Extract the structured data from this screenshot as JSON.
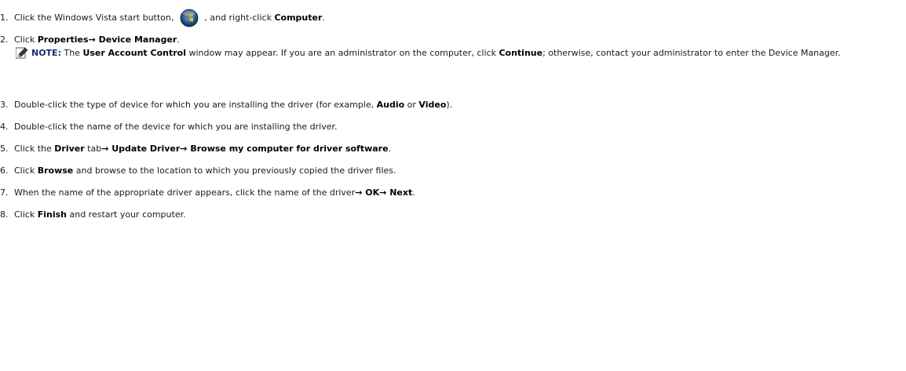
{
  "steps": [
    {
      "num": "1.",
      "parts": [
        {
          "t": "Click the Windows Vista start button, ",
          "b": false
        },
        {
          "icon": "windows-start-button"
        },
        {
          "t": " , and right-click ",
          "b": false
        },
        {
          "t": "Computer",
          "b": true
        },
        {
          "t": ".",
          "b": false
        }
      ]
    },
    {
      "num": "2.",
      "parts": [
        {
          "t": "Click ",
          "b": false
        },
        {
          "t": "Properties",
          "b": true
        },
        {
          "arrow": "→"
        },
        {
          "t": " Device Manager",
          "b": true
        },
        {
          "t": ".",
          "b": false
        }
      ]
    },
    {
      "num": "3.",
      "parts": [
        {
          "t": "Double-click the type of device for which you are installing the driver (for example, ",
          "b": false
        },
        {
          "t": "Audio",
          "b": true
        },
        {
          "t": " or ",
          "b": false
        },
        {
          "t": "Video",
          "b": true
        },
        {
          "t": ").",
          "b": false
        }
      ]
    },
    {
      "num": "4.",
      "parts": [
        {
          "t": "Double-click the name of the device for which you are installing the driver.",
          "b": false
        }
      ]
    },
    {
      "num": "5.",
      "parts": [
        {
          "t": "Click the ",
          "b": false
        },
        {
          "t": "Driver",
          "b": true
        },
        {
          "t": " tab",
          "b": false
        },
        {
          "arrow": "→"
        },
        {
          "t": " Update Driver",
          "b": true
        },
        {
          "arrow": "→"
        },
        {
          "t": " Browse my computer for driver software",
          "b": true
        },
        {
          "t": ".",
          "b": false
        }
      ]
    },
    {
      "num": "6.",
      "parts": [
        {
          "t": "Click ",
          "b": false
        },
        {
          "t": "Browse",
          "b": true
        },
        {
          "t": " and browse to the location to which you previously copied the driver files.",
          "b": false
        }
      ]
    },
    {
      "num": "7.",
      "parts": [
        {
          "t": "When the name of the appropriate driver appears, click the name of the driver",
          "b": false
        },
        {
          "arrow": "→"
        },
        {
          "t": " OK",
          "b": true
        },
        {
          "arrow": "→"
        },
        {
          "t": " Next",
          "b": true
        },
        {
          "t": ".",
          "b": false
        }
      ]
    },
    {
      "num": "8.",
      "parts": [
        {
          "t": "Click ",
          "b": false
        },
        {
          "t": "Finish",
          "b": true
        },
        {
          "t": " and restart your computer.",
          "b": false
        }
      ]
    }
  ],
  "note": {
    "label": "NOTE:",
    "parts": [
      {
        "t": " The ",
        "b": false
      },
      {
        "t": "User Account Control",
        "b": true
      },
      {
        "t": " window may appear. If you are an administrator on the computer, click ",
        "b": false
      },
      {
        "t": "Continue",
        "b": true
      },
      {
        "t": "; otherwise, contact your administrator to enter the Device Manager.",
        "b": false
      }
    ]
  }
}
